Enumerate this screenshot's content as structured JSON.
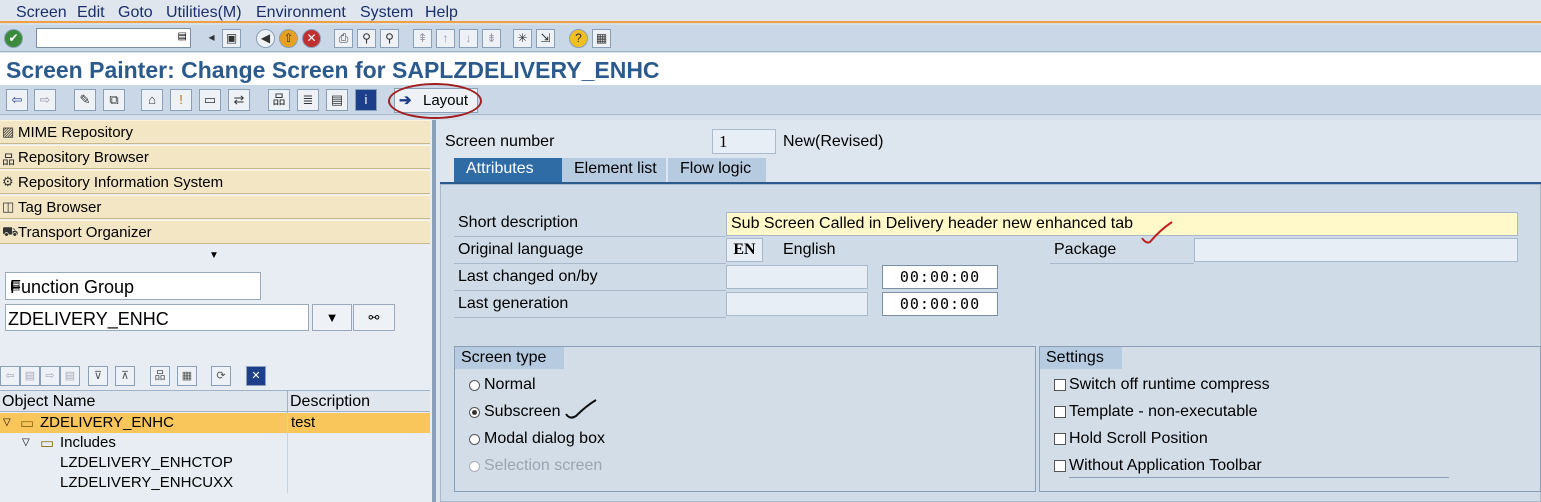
{
  "menu": [
    "Screen",
    "Edit",
    "Goto",
    "Utilities(M)",
    "Environment",
    "System",
    "Help"
  ],
  "title": "Screen Painter: Change Screen for SAPLZDELIVERY_ENHC",
  "toolbar": {
    "layout_label": "Layout"
  },
  "nav": {
    "items": [
      {
        "label": "MIME Repository",
        "icon": "mime-icon"
      },
      {
        "label": "Repository Browser",
        "icon": "hierarchy-icon"
      },
      {
        "label": "Repository Information System",
        "icon": "info-system-icon"
      },
      {
        "label": "Tag Browser",
        "icon": "tag-icon"
      },
      {
        "label": "Transport Organizer",
        "icon": "truck-icon"
      }
    ]
  },
  "object_list": {
    "type_value": "Function Group",
    "name_value": "ZDELIVERY_ENHC",
    "columns": [
      "Object Name",
      "Description"
    ],
    "rows": [
      {
        "name": "ZDELIVERY_ENHC",
        "desc": "test"
      },
      {
        "name": "Includes",
        "desc": ""
      },
      {
        "name": "LZDELIVERY_ENHCTOP",
        "desc": ""
      },
      {
        "name": "LZDELIVERY_ENHCUXX",
        "desc": ""
      }
    ]
  },
  "screen": {
    "number_label": "Screen number",
    "number_value": "1",
    "status": "New(Revised)",
    "tabs": [
      "Attributes",
      "Element list",
      "Flow logic"
    ],
    "short_desc_label": "Short description",
    "short_desc_value": "Sub Screen Called in Delivery header new enhanced tab",
    "orig_lang_label": "Original language",
    "orig_lang_code": "EN",
    "orig_lang_name": "English",
    "package_label": "Package",
    "package_value": "",
    "last_changed_label": "Last changed on/by",
    "last_changed_time": "00:00:00",
    "last_gen_label": "Last generation",
    "last_gen_time": "00:00:00",
    "screen_type": {
      "title": "Screen type",
      "options": [
        "Normal",
        "Subscreen",
        "Modal dialog box",
        "Selection screen"
      ],
      "selected": "Subscreen"
    },
    "settings": {
      "title": "Settings",
      "options": [
        "Switch off runtime compress",
        "Template - non-executable",
        "Hold Scroll Position",
        "Without Application Toolbar"
      ]
    }
  }
}
